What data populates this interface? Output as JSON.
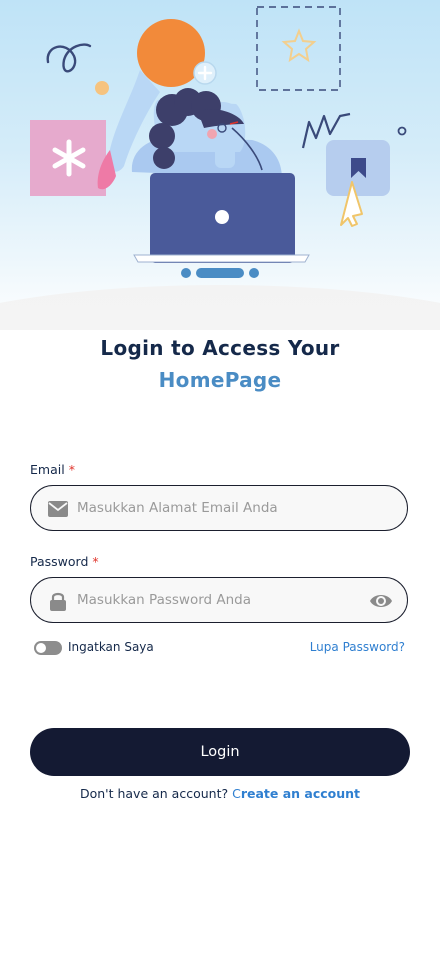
{
  "title": {
    "line1": "Login to Access Your",
    "line2": "HomePage"
  },
  "email": {
    "label": "Email",
    "required_mark": "*",
    "placeholder": "Masukkan Alamat Email Anda"
  },
  "password": {
    "label": "Password",
    "required_mark": "*",
    "placeholder": "Masukkan Password Anda"
  },
  "remember": {
    "label": "Ingatkan Saya",
    "checked": false
  },
  "forgot_link": "Lupa Password?",
  "login_button": "Login",
  "signup": {
    "prompt": "Don't have an account? ",
    "link_first": "C",
    "link_rest": "reate an account"
  },
  "carousel": {
    "page_count": 3,
    "active_index": 1
  },
  "colors": {
    "primary_dark": "#141a33",
    "heading": "#15294a",
    "accent_blue": "#4a8cc4",
    "link": "#2f7fd0",
    "required": "#e0342b"
  },
  "icons": {
    "email": "mail-icon",
    "password": "lock-icon",
    "visibility": "eye-icon"
  }
}
